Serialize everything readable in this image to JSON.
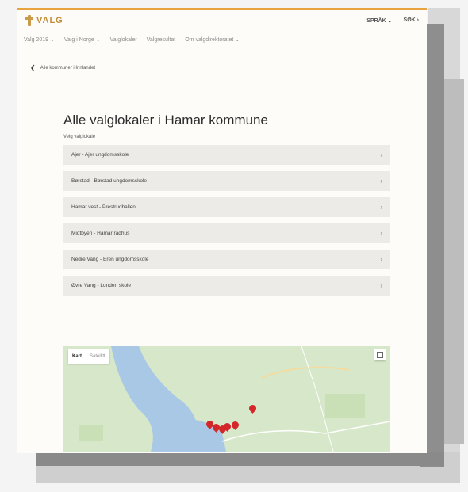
{
  "header": {
    "logo_text": "VALG",
    "menu": [
      {
        "label": "SPRÅK ⌄"
      },
      {
        "label": "SØK ›"
      }
    ]
  },
  "nav": {
    "items": [
      {
        "label": "Valg 2019 ⌄"
      },
      {
        "label": "Valg i Norge ⌄"
      },
      {
        "label": "Valglokaler"
      },
      {
        "label": "Valgresultat"
      },
      {
        "label": "Om valgdirektoratet ⌄"
      }
    ]
  },
  "back_link": {
    "label": "Alle kommuner i Innlandet"
  },
  "page": {
    "title": "Alle valglokaler i Hamar kommune",
    "subtitle": "Velg valglokale",
    "locations": [
      {
        "label": "Ajer - Ajer ungdomsskole"
      },
      {
        "label": "Børstad - Børstad ungdomsskole"
      },
      {
        "label": "Hamar vest - Prestrudhallen"
      },
      {
        "label": "Midtbyen - Hamar rådhus"
      },
      {
        "label": "Nedre Vang - Eren ungdomsskole"
      },
      {
        "label": "Øvre Vang - Lunden skole"
      }
    ]
  },
  "map": {
    "tab_map": "Kart",
    "tab_satellite": "Satellitt",
    "water_color": "#a9c8e6",
    "land_color": "#d7e7c9",
    "pin_color": "#d4272a"
  }
}
